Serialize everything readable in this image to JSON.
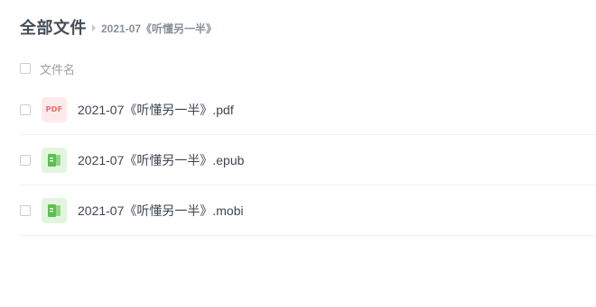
{
  "breadcrumb": {
    "root": "全部文件",
    "current": "2021-07《听懂另一半》"
  },
  "list": {
    "header_label": "文件名",
    "files": [
      {
        "name": "2021-07《听懂另一半》.pdf",
        "icon": "pdf-file-icon",
        "icon_text": "PDF"
      },
      {
        "name": "2021-07《听懂另一半》.epub",
        "icon": "ebook-file-icon"
      },
      {
        "name": "2021-07《听懂另一半》.mobi",
        "icon": "ebook-file-icon"
      }
    ]
  },
  "colors": {
    "pdf_icon": "#ef6b6b",
    "pdf_icon_bg": "#fdeaea",
    "book_icon": "#5cbf4f",
    "book_icon_bg": "#e3f5df"
  }
}
